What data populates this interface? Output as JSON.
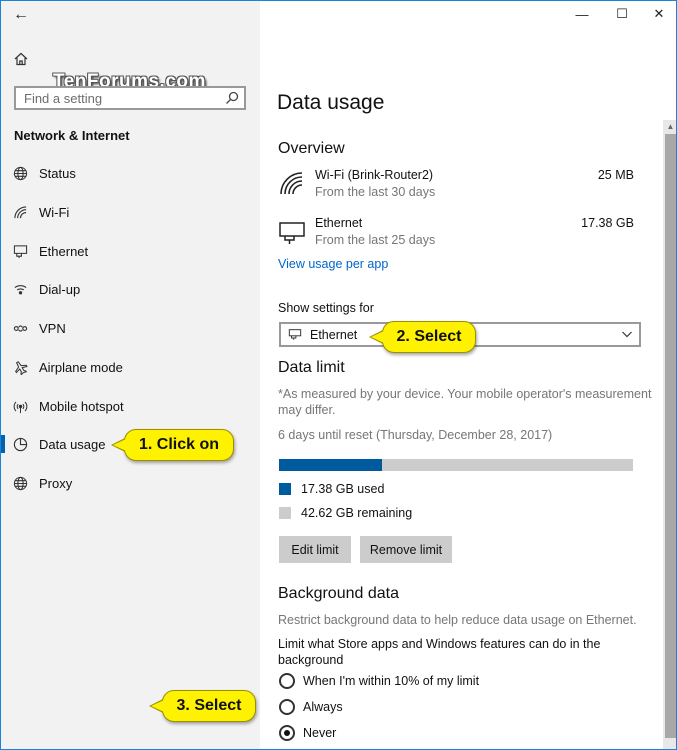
{
  "window": {
    "back_glyph": "←",
    "minimize_glyph": "—",
    "maximize_glyph": "☐",
    "close_glyph": "✕"
  },
  "watermark": "TenForums.com",
  "sidebar": {
    "search_placeholder": "Find a setting",
    "section_title": "Network & Internet",
    "items": [
      {
        "label": "Status",
        "icon": "globe-status-icon"
      },
      {
        "label": "Wi-Fi",
        "icon": "wifi-icon"
      },
      {
        "label": "Ethernet",
        "icon": "ethernet-icon"
      },
      {
        "label": "Dial-up",
        "icon": "dial-up-icon"
      },
      {
        "label": "VPN",
        "icon": "vpn-icon"
      },
      {
        "label": "Airplane mode",
        "icon": "airplane-icon"
      },
      {
        "label": "Mobile hotspot",
        "icon": "hotspot-icon"
      },
      {
        "label": "Data usage",
        "icon": "data-usage-icon",
        "active": true
      },
      {
        "label": "Proxy",
        "icon": "globe-proxy-icon"
      }
    ]
  },
  "callouts": {
    "one": "1. Click on",
    "two": "2. Select",
    "three": "3. Select"
  },
  "main": {
    "page_title": "Data usage",
    "overview": {
      "heading": "Overview",
      "rows": [
        {
          "name": "Wi-Fi (Brink-Router2)",
          "sub": "From the last 30 days",
          "value": "25 MB"
        },
        {
          "name": "Ethernet",
          "sub": "From the last 25 days",
          "value": "17.38 GB"
        }
      ],
      "link": "View usage per app"
    },
    "show_settings_for": {
      "label": "Show settings for",
      "selected": "Ethernet"
    },
    "data_limit": {
      "heading": "Data limit",
      "note_line1": "*As measured by your device. Your mobile operator's measurement",
      "note_line2": "may differ.",
      "reset": "6 days until reset (Thursday, December 28, 2017)",
      "used_fraction": 0.29,
      "used_label": "17.38 GB used",
      "remaining_label": "42.62 GB remaining",
      "used_color": "#005a9e",
      "remaining_color": "#cccccc",
      "edit_button": "Edit limit",
      "remove_button": "Remove limit"
    },
    "background_data": {
      "heading": "Background data",
      "desc": "Restrict background data to help reduce data usage on Ethernet.",
      "question_line1": "Limit what Store apps and Windows features can do in the",
      "question_line2": "background",
      "options": [
        {
          "label": "When I'm within 10% of my limit",
          "checked": false
        },
        {
          "label": "Always",
          "checked": false
        },
        {
          "label": "Never",
          "checked": true
        }
      ]
    }
  },
  "colors": {
    "accent": "#0063b1",
    "link": "#0066cc",
    "callout": "#fff200"
  }
}
